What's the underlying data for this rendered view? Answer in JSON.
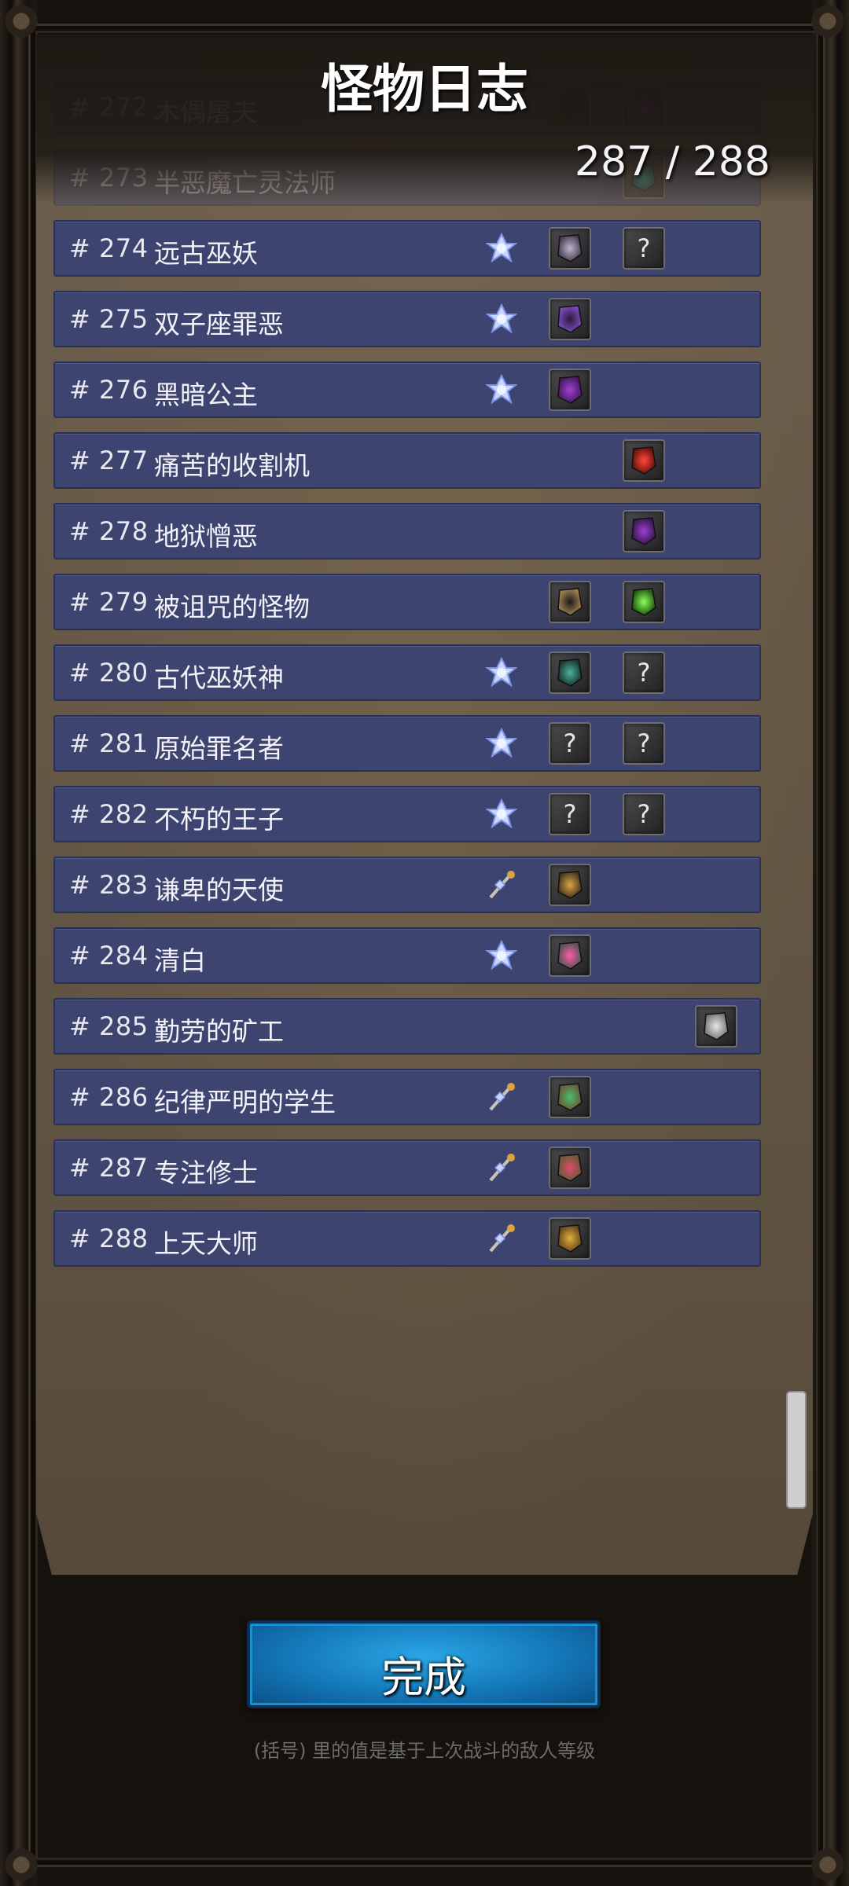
{
  "header": {
    "title": "怪物日志",
    "counter": "287 / 288"
  },
  "rows": [
    {
      "num": "# 272",
      "name": "木偶屠夫",
      "gem": "none",
      "slots": [
        "dark-staff",
        "purple-rune"
      ]
    },
    {
      "num": "# 273",
      "name": "半恶魔亡灵法师",
      "gem": "none",
      "slots": [
        "none",
        "teal-rune"
      ]
    },
    {
      "num": "# 274",
      "name": "远古巫妖",
      "gem": "crystal",
      "slots": [
        "scythe",
        "unknown"
      ]
    },
    {
      "num": "# 275",
      "name": "双子座罪恶",
      "gem": "crystal",
      "slots": [
        "dark-cloak",
        "none"
      ]
    },
    {
      "num": "# 276",
      "name": "黑暗公主",
      "gem": "crystal",
      "slots": [
        "purple-glove",
        "none"
      ]
    },
    {
      "num": "# 277",
      "name": "痛苦的收割机",
      "gem": "none",
      "slots": [
        "none",
        "red-rune"
      ]
    },
    {
      "num": "# 278",
      "name": "地狱憎恶",
      "gem": "none",
      "slots": [
        "none",
        "purple-rune"
      ]
    },
    {
      "num": "# 279",
      "name": "被诅咒的怪物",
      "gem": "none",
      "slots": [
        "black-necklace",
        "green-rune"
      ]
    },
    {
      "num": "# 280",
      "name": "古代巫妖神",
      "gem": "crystal",
      "slots": [
        "green-claw",
        "unknown"
      ]
    },
    {
      "num": "# 281",
      "name": "原始罪名者",
      "gem": "crystal",
      "slots": [
        "unknown",
        "unknown"
      ]
    },
    {
      "num": "# 282",
      "name": "不朽的王子",
      "gem": "crystal",
      "slots": [
        "unknown",
        "unknown"
      ]
    },
    {
      "num": "# 283",
      "name": "谦卑的天使",
      "gem": "wand",
      "slots": [
        "golden-staff",
        "none"
      ]
    },
    {
      "num": "# 284",
      "name": "清白",
      "gem": "crystal",
      "slots": [
        "pink-pendant",
        "none"
      ]
    },
    {
      "num": "# 285",
      "name": "勤劳的矿工",
      "gem": "none",
      "slots": [
        "none",
        "none",
        "silver-ore"
      ]
    },
    {
      "num": "# 286",
      "name": "纪律严明的学生",
      "gem": "wand",
      "slots": [
        "green-amulet",
        "none"
      ]
    },
    {
      "num": "# 287",
      "name": "专注修士",
      "gem": "wand",
      "slots": [
        "red-amulet",
        "none"
      ]
    },
    {
      "num": "# 288",
      "name": "上天大师",
      "gem": "wand",
      "slots": [
        "gold-amulet",
        "none"
      ]
    }
  ],
  "footer": {
    "done_label": "完成",
    "note": "(括号) 里的值是基于上次战斗的敌人等级"
  }
}
